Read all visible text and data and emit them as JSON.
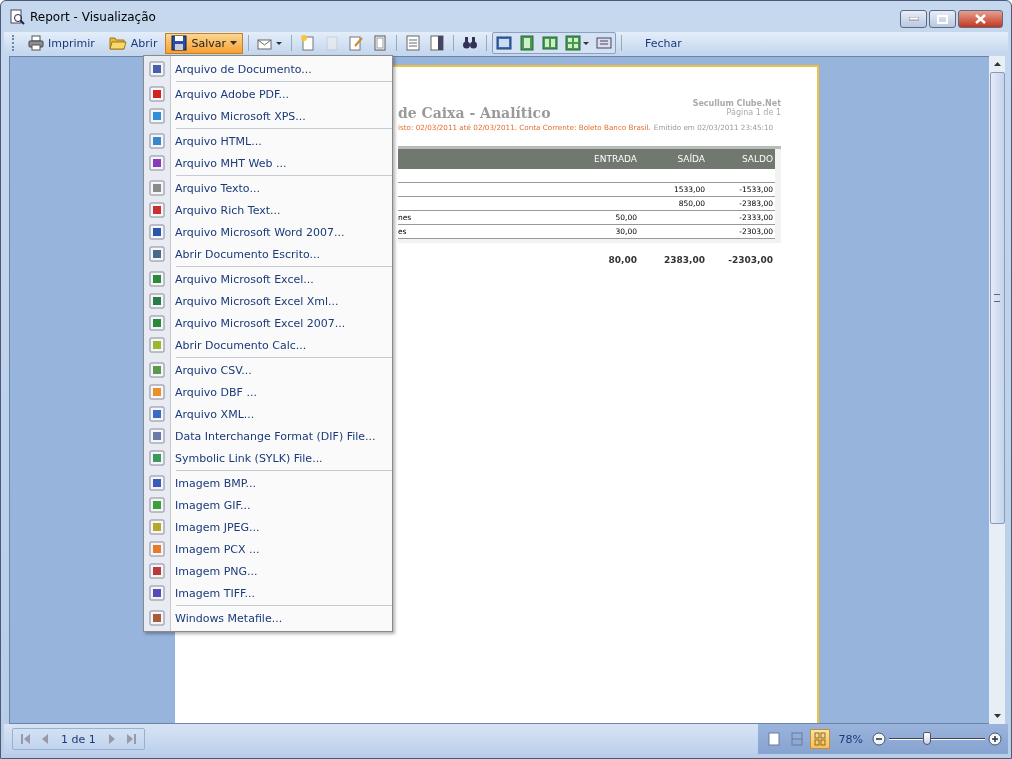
{
  "window": {
    "title": "Report - Visualização"
  },
  "toolbar": {
    "buttons": [
      {
        "label": "Imprimir",
        "kind": "print",
        "selected": false
      },
      {
        "label": "Abrir",
        "kind": "open",
        "selected": false
      },
      {
        "label": "Salvar",
        "kind": "save",
        "selected": true
      }
    ],
    "close_label": "Fechar"
  },
  "menu": {
    "groups": [
      {
        "items": [
          {
            "label": "Arquivo de Documento...",
            "color": "#4a5fa8"
          }
        ]
      },
      {
        "items": [
          {
            "label": "Arquivo Adobe PDF...",
            "color": "#d42020"
          },
          {
            "label": "Arquivo Microsoft XPS...",
            "color": "#2f8fd8"
          }
        ]
      },
      {
        "items": [
          {
            "label": "Arquivo HTML...",
            "color": "#3a86c8"
          },
          {
            "label": "Arquivo MHT Web ...",
            "color": "#8a3ab8"
          }
        ]
      },
      {
        "items": [
          {
            "label": "Arquivo Texto...",
            "color": "#8a8a8a"
          },
          {
            "label": "Arquivo Rich Text...",
            "color": "#c83030"
          },
          {
            "label": "Arquivo Microsoft Word 2007...",
            "color": "#2a55a8"
          },
          {
            "label": "Abrir Documento Escrito...",
            "color": "#4a6a8a"
          }
        ]
      },
      {
        "items": [
          {
            "label": "Arquivo Microsoft Excel...",
            "color": "#2a8a3a"
          },
          {
            "label": "Arquivo Microsoft Excel Xml...",
            "color": "#2a7a4a"
          },
          {
            "label": "Arquivo Microsoft Excel 2007...",
            "color": "#2a8a3a"
          },
          {
            "label": "Abrir Documento Calc...",
            "color": "#9ab82a"
          }
        ]
      },
      {
        "items": [
          {
            "label": "Arquivo CSV...",
            "color": "#5a9a4a"
          },
          {
            "label": "Arquivo DBF ...",
            "color": "#e8902a"
          },
          {
            "label": "Arquivo XML...",
            "color": "#3a6ac8"
          },
          {
            "label": "Data Interchange Format (DIF) File...",
            "color": "#6a7aa8"
          },
          {
            "label": "Symbolic Link (SYLK) File...",
            "color": "#3a9a5a"
          }
        ]
      },
      {
        "items": [
          {
            "label": "Imagem BMP...",
            "color": "#3a5ab8"
          },
          {
            "label": "Imagem GIF...",
            "color": "#3aa03a"
          },
          {
            "label": "Imagem JPEG...",
            "color": "#b8a82a"
          },
          {
            "label": "Imagem PCX ...",
            "color": "#e87a2a"
          },
          {
            "label": "Imagem PNG...",
            "color": "#b83a3a"
          },
          {
            "label": "Imagem TIFF...",
            "color": "#5a4ab8"
          }
        ]
      },
      {
        "items": [
          {
            "label": "Windows Metafile...",
            "color": "#a85a3a"
          }
        ]
      }
    ]
  },
  "report": {
    "title": "de Caixa - Analítico",
    "company": "Secullum Clube.Net",
    "page": "Página 1 de 1",
    "filter": "isto: 02/03/2011 até 02/03/2011. Conta Corrente: Boleto Banco Brasil.",
    "issued": "Emitido em 02/03/2011 23:45:10",
    "columns": [
      "",
      "ENTRADA",
      "SAÍDA",
      "SALDO"
    ],
    "rows": [
      [
        "",
        "",
        "",
        ""
      ],
      [
        "",
        "",
        "1533,00",
        "-1533,00"
      ],
      [
        "",
        "",
        "850,00",
        "-2383,00"
      ],
      [
        "nes",
        "50,00",
        "",
        "-2333,00"
      ],
      [
        "es",
        "30,00",
        "",
        "-2303,00"
      ]
    ],
    "totals": [
      "80,00",
      "2383,00",
      "-2303,00"
    ]
  },
  "status_bar": {
    "page": "1 de 1",
    "views": [
      {
        "kind": "single",
        "selected": false
      },
      {
        "kind": "width",
        "selected": false
      },
      {
        "kind": "multi",
        "selected": true
      }
    ],
    "zoom": "78%",
    "zoom_slider": {
      "level": 0.4
    }
  }
}
